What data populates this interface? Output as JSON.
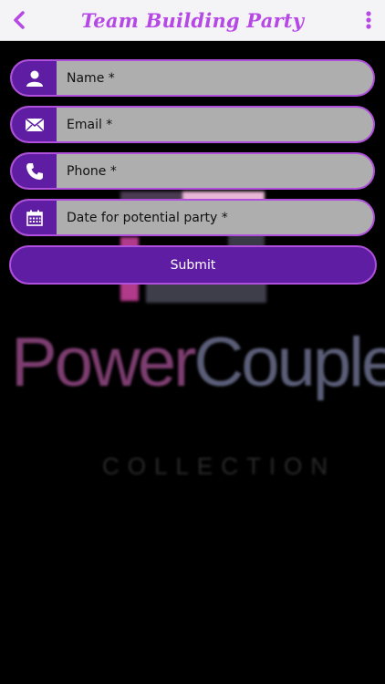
{
  "header": {
    "title": "Team Building Party",
    "back_icon": "chevron-left-icon",
    "menu_icon": "more-vertical-icon"
  },
  "form": {
    "fields": [
      {
        "placeholder": "Name *",
        "icon": "person-icon"
      },
      {
        "placeholder": "Email *",
        "icon": "envelope-icon"
      },
      {
        "placeholder": "Phone *",
        "icon": "phone-icon"
      },
      {
        "placeholder": "Date for potential party *",
        "icon": "calendar-icon"
      }
    ],
    "submit_label": "Submit"
  },
  "background_logo": {
    "word1": "Power",
    "word2": "Couple",
    "sub": "COLLECTION"
  },
  "colors": {
    "accent": "#b648e6",
    "button": "#5e1da3",
    "border": "#b04fdc",
    "field_bg": "#aeaeae"
  }
}
